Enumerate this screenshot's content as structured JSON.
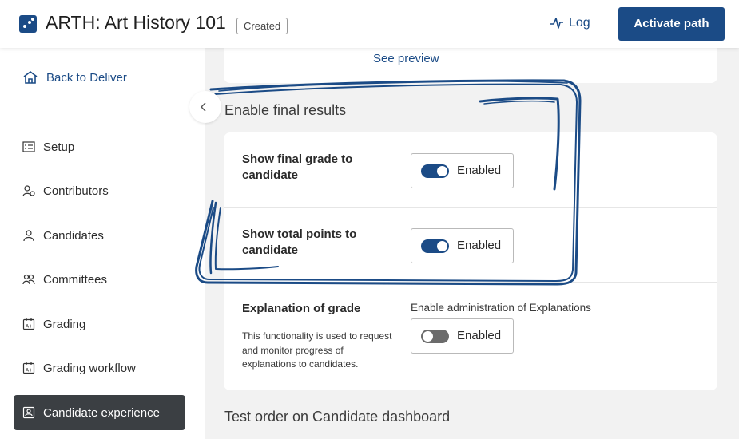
{
  "header": {
    "title": "ARTH: Art History 101",
    "status_badge": "Created",
    "log_label": "Log",
    "activate_label": "Activate path"
  },
  "sidebar": {
    "back_label": "Back to Deliver",
    "items": [
      {
        "label": "Setup",
        "icon": "setup-icon"
      },
      {
        "label": "Contributors",
        "icon": "contributors-icon"
      },
      {
        "label": "Candidates",
        "icon": "candidate-icon"
      },
      {
        "label": "Committees",
        "icon": "committees-icon"
      },
      {
        "label": "Grading",
        "icon": "grading-icon"
      },
      {
        "label": "Grading workflow",
        "icon": "grading-workflow-icon"
      },
      {
        "label": "Candidate experience",
        "icon": "candidate-experience-icon",
        "active": true
      }
    ]
  },
  "main": {
    "see_preview": "See preview",
    "final_results": {
      "title": "Enable final results",
      "settings": [
        {
          "label": "Show final grade to candidate",
          "toggle_label": "Enabled",
          "on": true
        },
        {
          "label": "Show total points to candidate",
          "toggle_label": "Enabled",
          "on": true
        }
      ]
    },
    "explanation": {
      "label": "Explanation of grade",
      "description": "This functionality is used to request and monitor progress of explanations to candidates.",
      "sublabel": "Enable administration of Explanations",
      "toggle_label": "Enabled",
      "on": false
    },
    "test_order_title": "Test order on Candidate dashboard"
  },
  "colors": {
    "brand": "#1b4b86",
    "active_nav": "#3b3f43",
    "annotation": "#1b4b86"
  }
}
